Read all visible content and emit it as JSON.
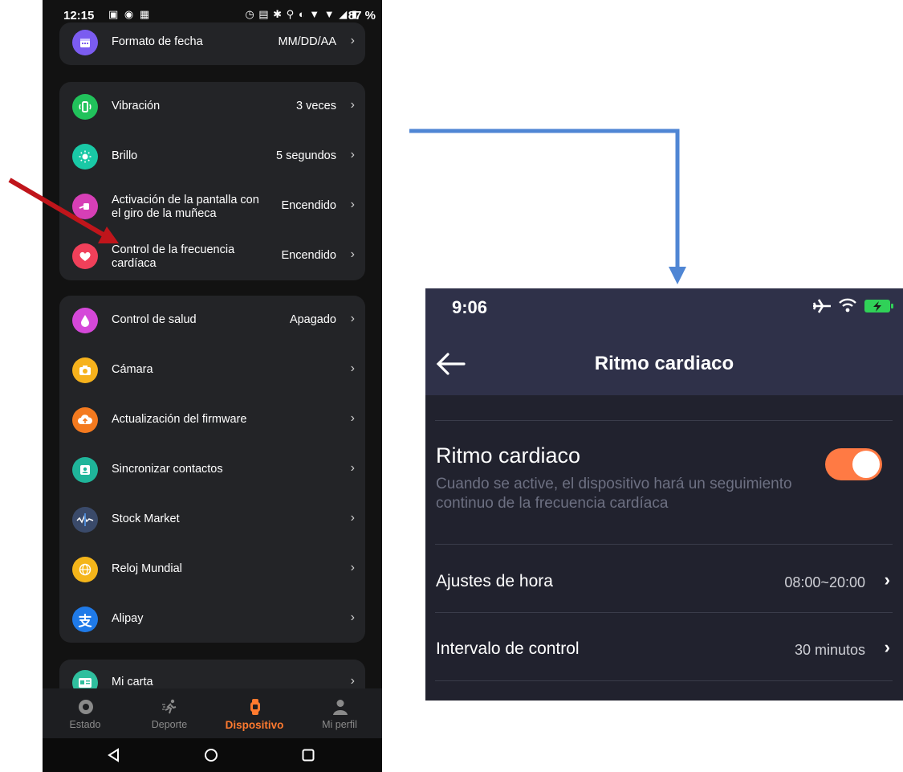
{
  "left_phone": {
    "status": {
      "time": "12:15",
      "battery": "87 %"
    },
    "items": [
      {
        "label": "Formato de fecha",
        "value": "MM/DD/AA",
        "icon": "calendar-icon",
        "color": "#7b5cf0"
      },
      {
        "label": "Vibración",
        "value": "3 veces",
        "icon": "vibration-icon",
        "color": "#21c25b"
      },
      {
        "label": "Brillo",
        "value": "5 segundos",
        "icon": "brightness-icon",
        "color": "#19c9a6"
      },
      {
        "label": "Activación de la pantalla con el giro de la muñeca",
        "value": "Encendido",
        "icon": "wrist-raise-icon",
        "color": "#d63fb6"
      },
      {
        "label": "Control de la frecuencia cardíaca",
        "value": "Encendido",
        "icon": "heart-icon",
        "color": "#f0405a"
      },
      {
        "label": "Control de salud",
        "value": "Apagado",
        "icon": "health-drop-icon",
        "color": "#d548d9"
      },
      {
        "label": "Cámara",
        "value": "",
        "icon": "camera-icon",
        "color": "#f6b21c"
      },
      {
        "label": "Actualización del firmware",
        "value": "",
        "icon": "cloud-upload-icon",
        "color": "#f47a1f"
      },
      {
        "label": "Sincronizar contactos",
        "value": "",
        "icon": "contacts-icon",
        "color": "#1fb59a"
      },
      {
        "label": "Stock Market",
        "value": "",
        "icon": "stock-market-icon",
        "color": "#3a4a6a"
      },
      {
        "label": "Reloj Mundial",
        "value": "",
        "icon": "world-clock-icon",
        "color": "#f4b51a"
      },
      {
        "label": "Alipay",
        "value": "",
        "icon": "alipay-icon",
        "color": "#1f7ae8"
      },
      {
        "label": "Mi carta",
        "value": "",
        "icon": "card-icon",
        "color": "#2fbf9e"
      }
    ],
    "tabs": [
      {
        "label": "Estado",
        "icon": "status-icon"
      },
      {
        "label": "Deporte",
        "icon": "running-icon"
      },
      {
        "label": "Dispositivo",
        "icon": "watch-icon"
      },
      {
        "label": "Mi perfil",
        "icon": "profile-icon"
      }
    ],
    "active_tab": "Dispositivo",
    "accent_color": "#ff7a2f"
  },
  "right_phone": {
    "status": {
      "time": "9:06"
    },
    "header_title": "Ritmo cardiaco",
    "setting_title": "Ritmo cardiaco",
    "setting_description": "Cuando se active, el dispositivo hará un seguimiento continuo de la frecuencia cardíaca",
    "toggle_on": true,
    "toggle_color": "#ff7a44",
    "rows": [
      {
        "label": "Ajustes de hora",
        "value": "08:00~20:00"
      },
      {
        "label": "Intervalo de control",
        "value": "30 minutos"
      }
    ]
  },
  "annotations": {
    "arrow_color": "#c0151b",
    "connector_color": "#4f86d4"
  }
}
